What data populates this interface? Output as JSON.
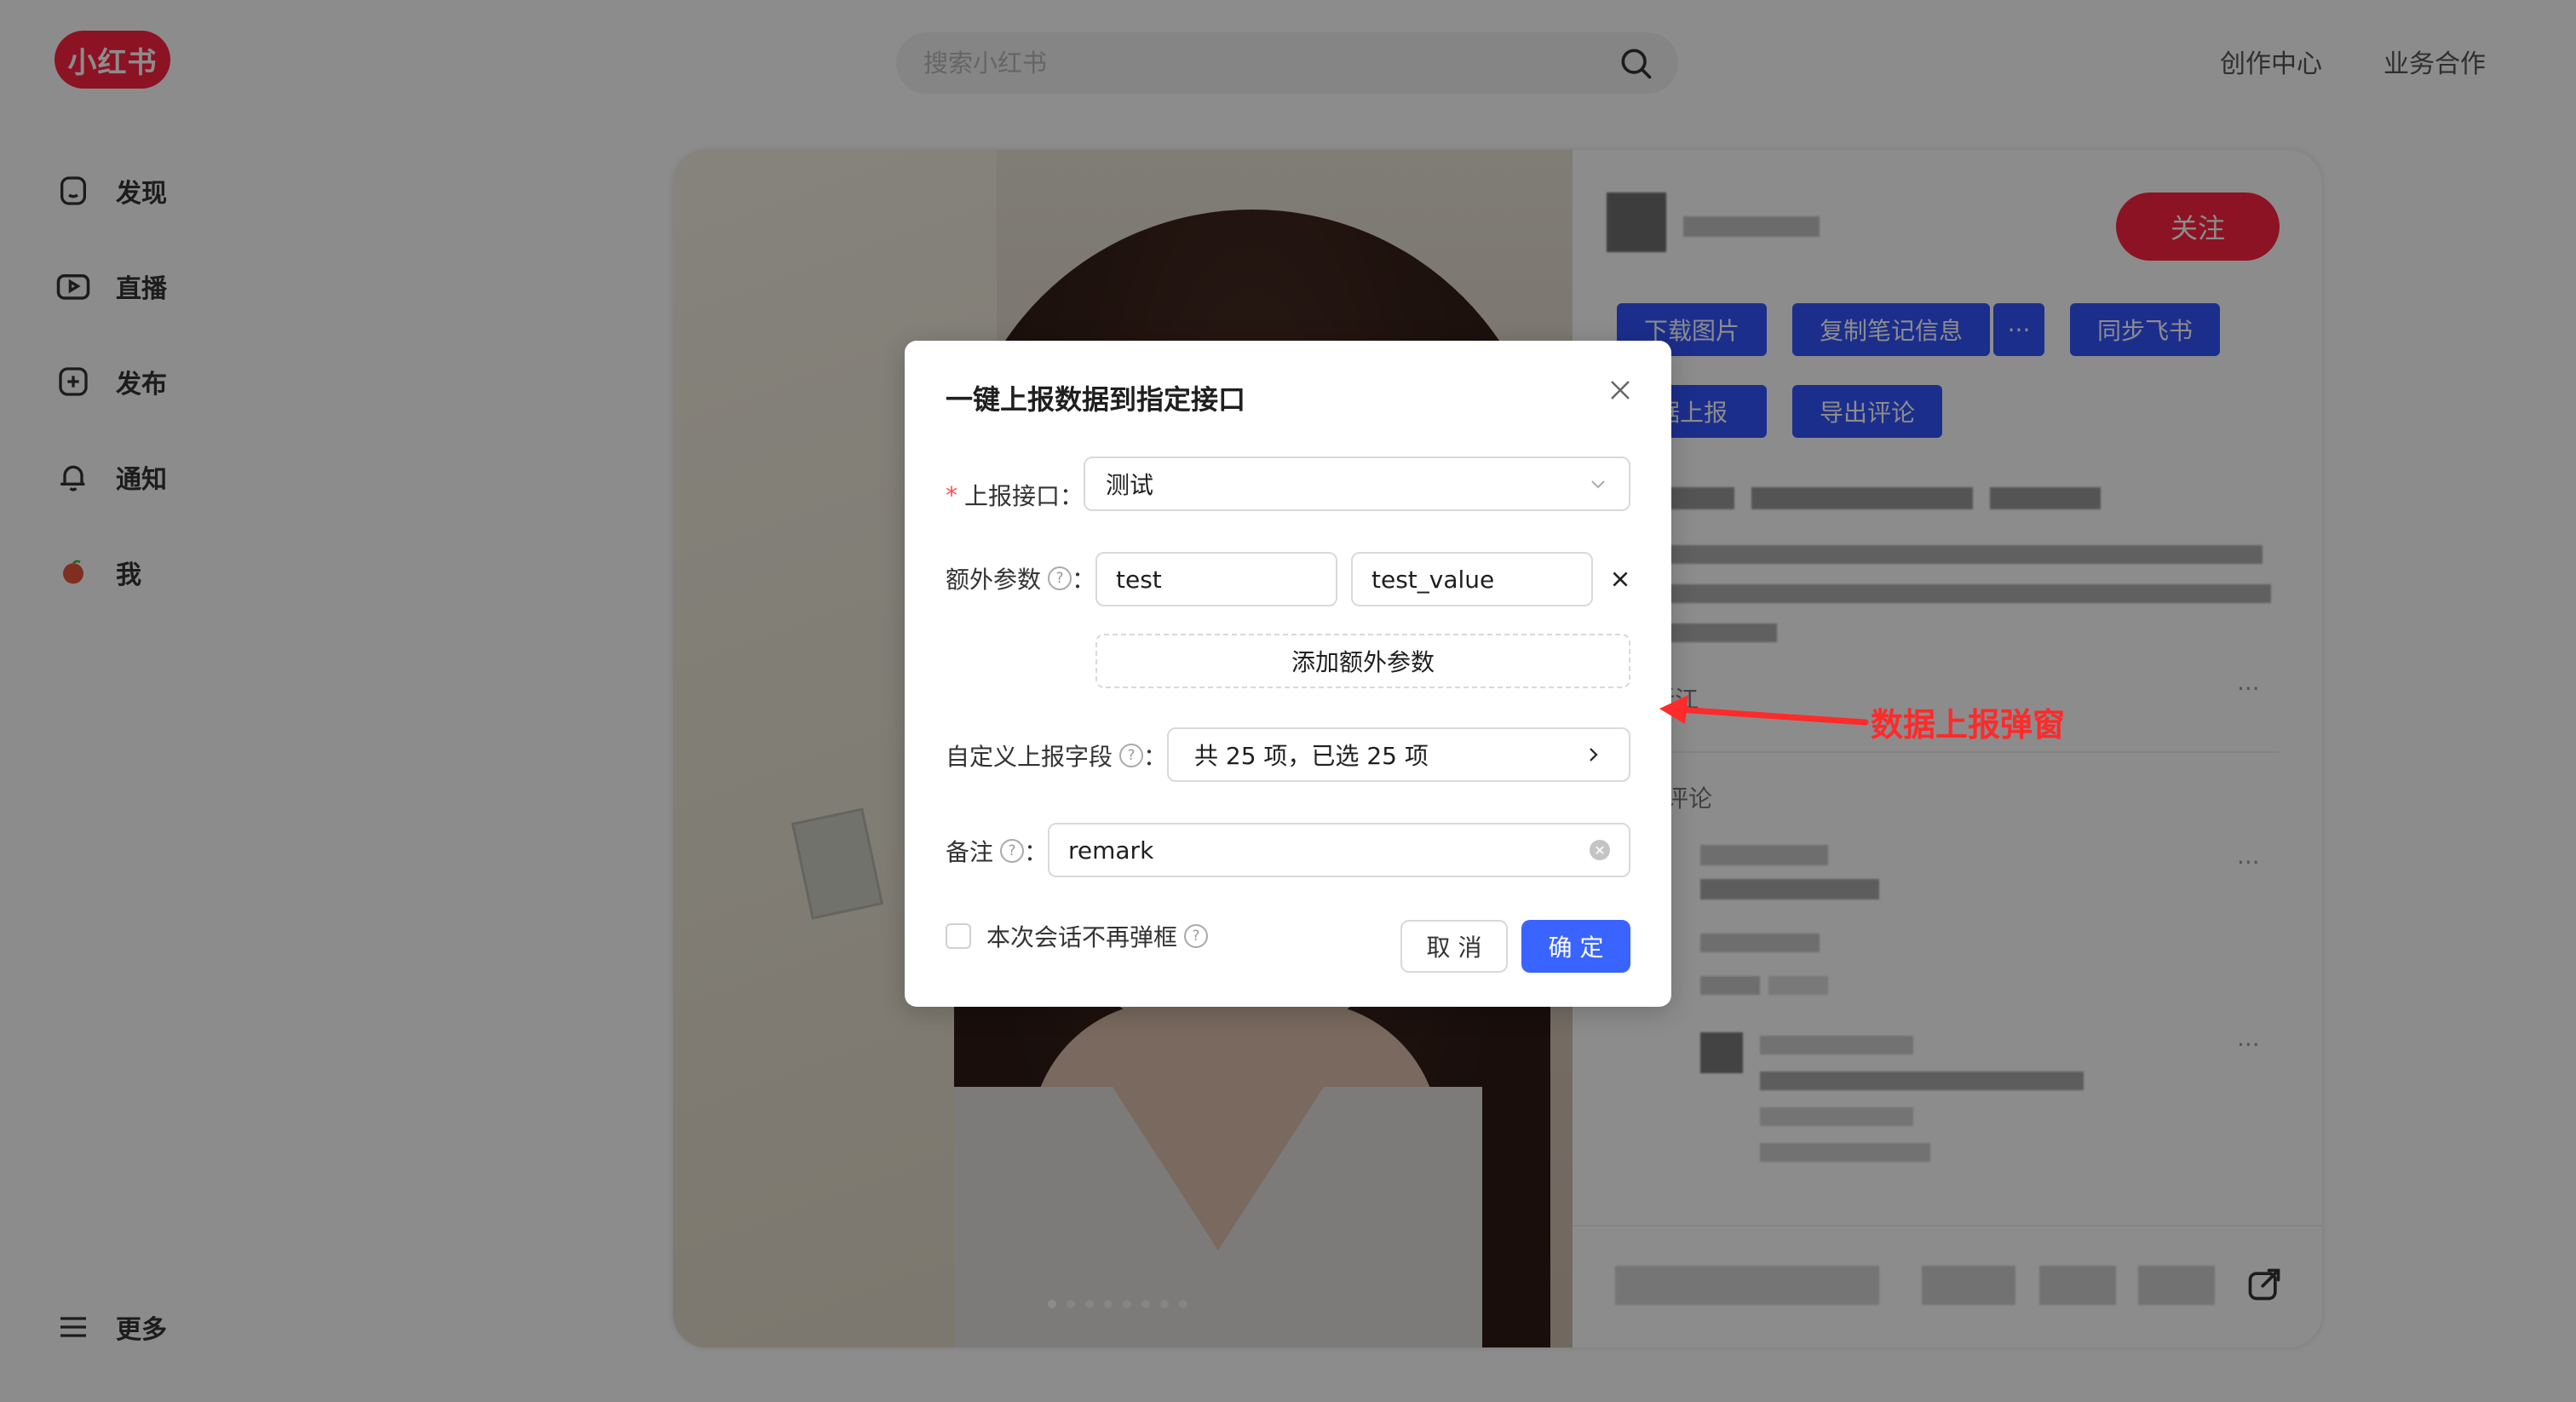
{
  "header": {
    "logo": "小红书",
    "search_placeholder": "搜索小红书",
    "links": [
      "创作中心",
      "业务合作"
    ]
  },
  "sidebar": {
    "items": [
      {
        "label": "发现",
        "icon": "home-icon"
      },
      {
        "label": "直播",
        "icon": "live-icon"
      },
      {
        "label": "发布",
        "icon": "add-icon"
      },
      {
        "label": "通知",
        "icon": "bell-icon"
      },
      {
        "label": "我",
        "icon": "avatar-icon"
      }
    ],
    "more": "更多"
  },
  "note": {
    "follow": "关注",
    "tools": [
      "下载图片",
      "复制笔记信息",
      "···",
      "同步飞书",
      "据上报",
      "导出评论"
    ],
    "location": "浙江",
    "comments_label": "条评论"
  },
  "modal": {
    "title": "一键上报数据到指定接口",
    "endpoint_label": "上报接口",
    "endpoint_value": "测试",
    "extra_label": "额外参数",
    "extra_key": "test",
    "extra_value": "test_value",
    "add_extra": "添加额外参数",
    "custom_label": "自定义上报字段",
    "custom_value": "共 25 项，已选 25 项",
    "remark_label": "备注",
    "remark_value": "remark",
    "no_popup_label": "本次会话不再弹框",
    "cancel": "取 消",
    "ok": "确 定"
  },
  "annotation": "数据上报弹窗",
  "colors": {
    "brand": "#ff2442",
    "primary": "#3355ff",
    "annotation": "#ff2a2a"
  }
}
